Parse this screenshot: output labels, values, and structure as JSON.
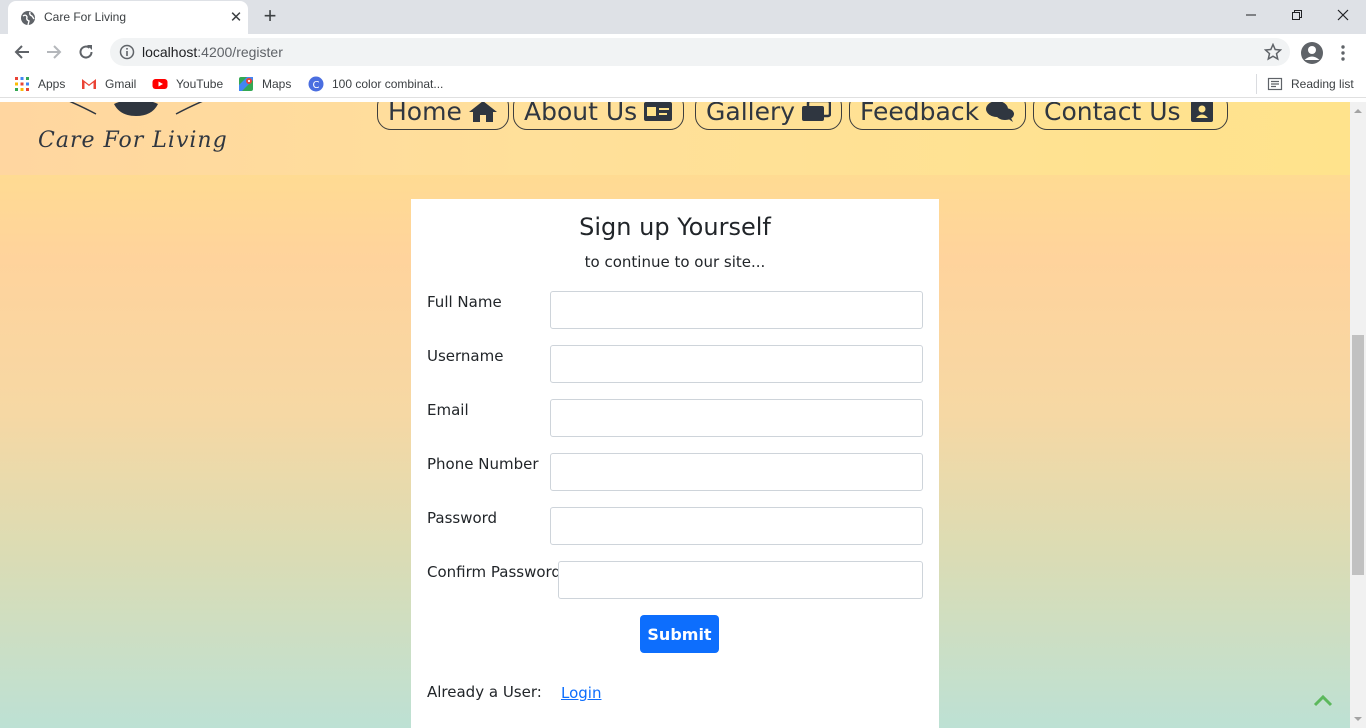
{
  "browser": {
    "tab_title": "Care For Living",
    "url_host": "localhost",
    "url_path": ":4200/register",
    "bookmarks": [
      {
        "label": "Apps",
        "icon": "apps-grid-icon"
      },
      {
        "label": "Gmail",
        "icon": "gmail-icon"
      },
      {
        "label": "YouTube",
        "icon": "youtube-icon"
      },
      {
        "label": "Maps",
        "icon": "maps-icon"
      },
      {
        "label": "100 color combinat...",
        "icon": "bookmark-site-icon"
      }
    ],
    "reading_list": "Reading list"
  },
  "site": {
    "logo_text": "Care For Living",
    "nav": [
      {
        "label": "Home",
        "icon": "home-icon"
      },
      {
        "label": "About Us",
        "icon": "id-card-icon"
      },
      {
        "label": "Gallery",
        "icon": "images-icon"
      },
      {
        "label": "Feedback",
        "icon": "comments-icon"
      },
      {
        "label": "Contact Us",
        "icon": "contact-book-icon"
      }
    ]
  },
  "form": {
    "title": "Sign up Yourself",
    "subtitle": "to continue to our site...",
    "fields": [
      {
        "label": "Full Name",
        "value": "",
        "placeholder": ""
      },
      {
        "label": "Username",
        "value": "",
        "placeholder": ""
      },
      {
        "label": "Email",
        "value": "",
        "placeholder": ""
      },
      {
        "label": "Phone Number",
        "value": "",
        "placeholder": ""
      },
      {
        "label": "Password",
        "value": "",
        "placeholder": ""
      },
      {
        "label": "Confirm Password",
        "value": "",
        "placeholder": ""
      }
    ],
    "submit_label": "Submit",
    "already_text": "Already a User:",
    "login_label": "Login"
  },
  "colors": {
    "accent": "#0d6efd",
    "header_text": "#2f3640",
    "back_to_top": "#5cb85c"
  }
}
